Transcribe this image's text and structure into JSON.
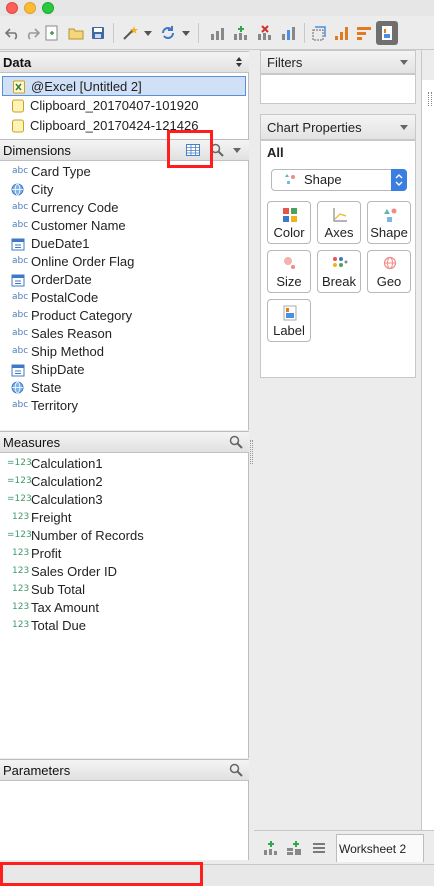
{
  "data_panel": {
    "title": "Data",
    "sources": [
      {
        "label": "@Excel [Untitled 2]",
        "selected": true
      },
      {
        "label": "Clipboard_20170407-101920",
        "selected": false
      },
      {
        "label": "Clipboard_20170424-121426",
        "selected": false
      }
    ]
  },
  "dimensions": {
    "title": "Dimensions",
    "items": [
      {
        "type": "abc",
        "label": "Card Type"
      },
      {
        "type": "geo",
        "label": "City"
      },
      {
        "type": "abc",
        "label": "Currency Code"
      },
      {
        "type": "abc",
        "label": "Customer Name"
      },
      {
        "type": "date",
        "label": "DueDate1"
      },
      {
        "type": "abc",
        "label": "Online Order Flag"
      },
      {
        "type": "date",
        "label": "OrderDate"
      },
      {
        "type": "abc",
        "label": "PostalCode"
      },
      {
        "type": "abc",
        "label": "Product Category"
      },
      {
        "type": "abc",
        "label": "Sales Reason"
      },
      {
        "type": "abc",
        "label": "Ship Method"
      },
      {
        "type": "date",
        "label": "ShipDate"
      },
      {
        "type": "geo",
        "label": "State"
      },
      {
        "type": "abc",
        "label": "Territory"
      }
    ]
  },
  "measures": {
    "title": "Measures",
    "items": [
      {
        "type": "calc",
        "label": "Calculation1"
      },
      {
        "type": "calc",
        "label": "Calculation2"
      },
      {
        "type": "calc",
        "label": "Calculation3"
      },
      {
        "type": "num",
        "label": "Freight"
      },
      {
        "type": "calc",
        "label": "Number of Records"
      },
      {
        "type": "num",
        "label": "Profit"
      },
      {
        "type": "num",
        "label": "Sales Order ID"
      },
      {
        "type": "num",
        "label": "Sub Total"
      },
      {
        "type": "num",
        "label": "Tax Amount"
      },
      {
        "type": "num",
        "label": "Total Due"
      }
    ]
  },
  "parameters": {
    "title": "Parameters"
  },
  "type_glyphs": {
    "abc": "abc",
    "num": "123",
    "calc": "=123"
  },
  "filters": {
    "title": "Filters"
  },
  "chart_properties": {
    "title": "Chart Properties",
    "section": "All",
    "select_value": "Shape",
    "buttons": [
      "Color",
      "Axes",
      "Shape",
      "Size",
      "Break",
      "Geo",
      "Label"
    ]
  },
  "bottom": {
    "worksheet_tab": "Worksheet 2"
  },
  "colors": {
    "selection": "#cfe0f7",
    "accent": "#4a90e2",
    "highlight": "#ff1e1e"
  }
}
